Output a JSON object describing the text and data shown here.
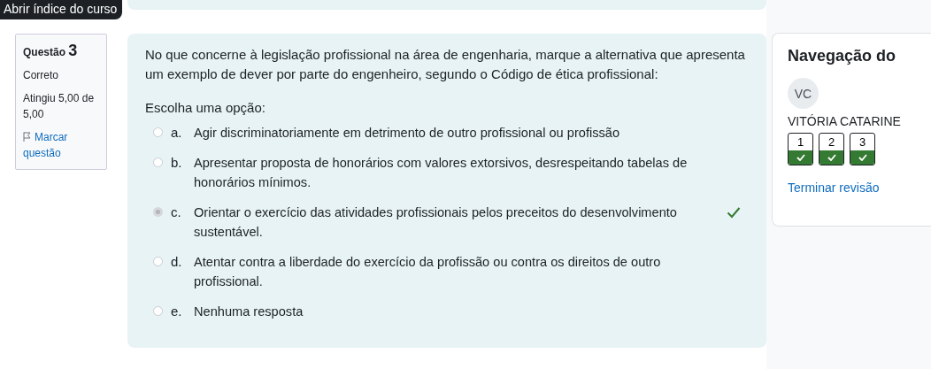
{
  "drawer_button": "Abrir índice do curso",
  "question_info": {
    "label": "Questão",
    "number": "3",
    "status": "Correto",
    "grade": "Atingiu 5,00 de 5,00",
    "flag_link": "Marcar questão"
  },
  "question": {
    "text": "No que concerne à legislação profissional na área de engenharia, marque a alternativa que apresenta um exemplo de dever por parte do engenheiro, segundo o Código de ética profissional:",
    "prompt": "Escolha uma opção:",
    "options": [
      {
        "letter": "a.",
        "text": "Agir discriminatoriamente em detrimento de outro profissional ou profissão",
        "selected": false,
        "correct": false
      },
      {
        "letter": "b.",
        "text": "Apresentar proposta de honorários com valores extorsivos, desrespeitando tabelas de honorários mínimos.",
        "selected": false,
        "correct": false
      },
      {
        "letter": "c.",
        "text": "Orientar o exercício das atividades profissionais pelos preceitos do desenvolvimento sustentável.",
        "selected": true,
        "correct": true
      },
      {
        "letter": "d.",
        "text": "Atentar contra a liberdade do exercício da profissão ou contra os direitos de outro profissional.",
        "selected": false,
        "correct": false
      },
      {
        "letter": "e.",
        "text": "Nenhuma resposta",
        "selected": false,
        "correct": false
      }
    ]
  },
  "navigation": {
    "title": "Navegação do",
    "avatar": "VC",
    "user": "VITÓRIA CATARINE",
    "questions": [
      {
        "number": "1",
        "correct": true
      },
      {
        "number": "2",
        "correct": true
      },
      {
        "number": "3",
        "correct": true
      }
    ],
    "finish_link": "Terminar revisão"
  }
}
